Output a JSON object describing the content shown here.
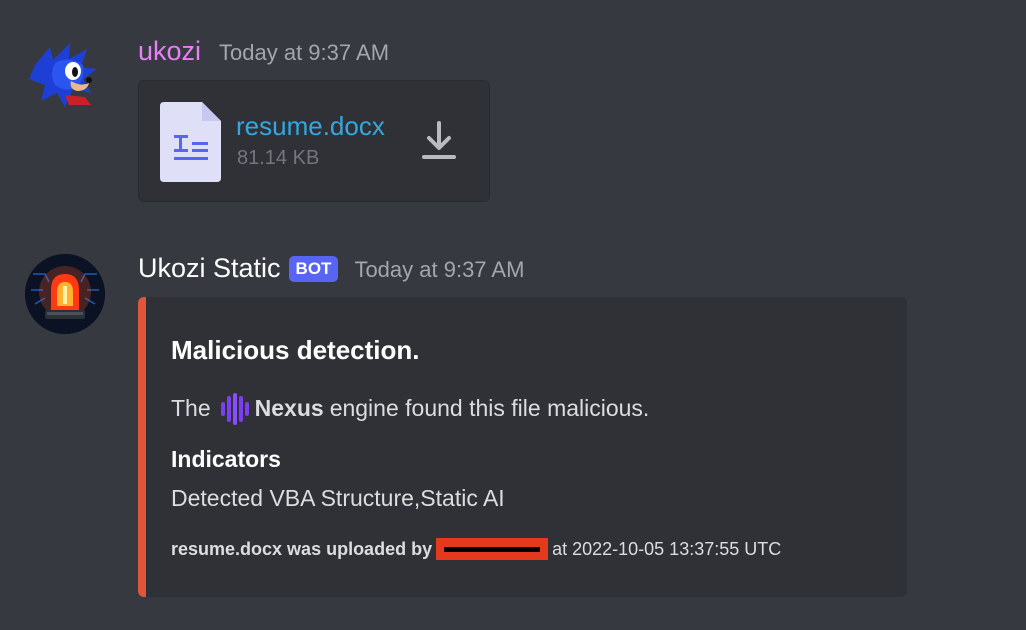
{
  "messages": [
    {
      "username": "ukozi",
      "timestamp": "Today at 9:37 AM",
      "attachment": {
        "file_name": "resume.docx",
        "file_size": "81.14 KB",
        "file_icon": "document-icon",
        "action_icon": "download-icon"
      }
    },
    {
      "username": "Ukozi Static",
      "badge": "BOT",
      "timestamp": "Today at 9:37 AM",
      "embed": {
        "accent_color": "#e0553b",
        "title": "Malicious detection.",
        "description_prefix": "The",
        "engine_name": "Nexus",
        "description_suffix": "engine found this file malicious.",
        "field_name": "Indicators",
        "field_value": "Detected VBA Structure,Static AI",
        "footer_prefix": "resume.docx was uploaded by",
        "footer_suffix": "at 2022-10-05 13:37:55 UTC"
      }
    }
  ],
  "colors": {
    "background": "#36393f",
    "embed_background": "#2f3136",
    "username_1": "#e580f5",
    "link": "#33a8e0",
    "bot_badge": "#5865f2",
    "redaction": "#e5391e"
  }
}
